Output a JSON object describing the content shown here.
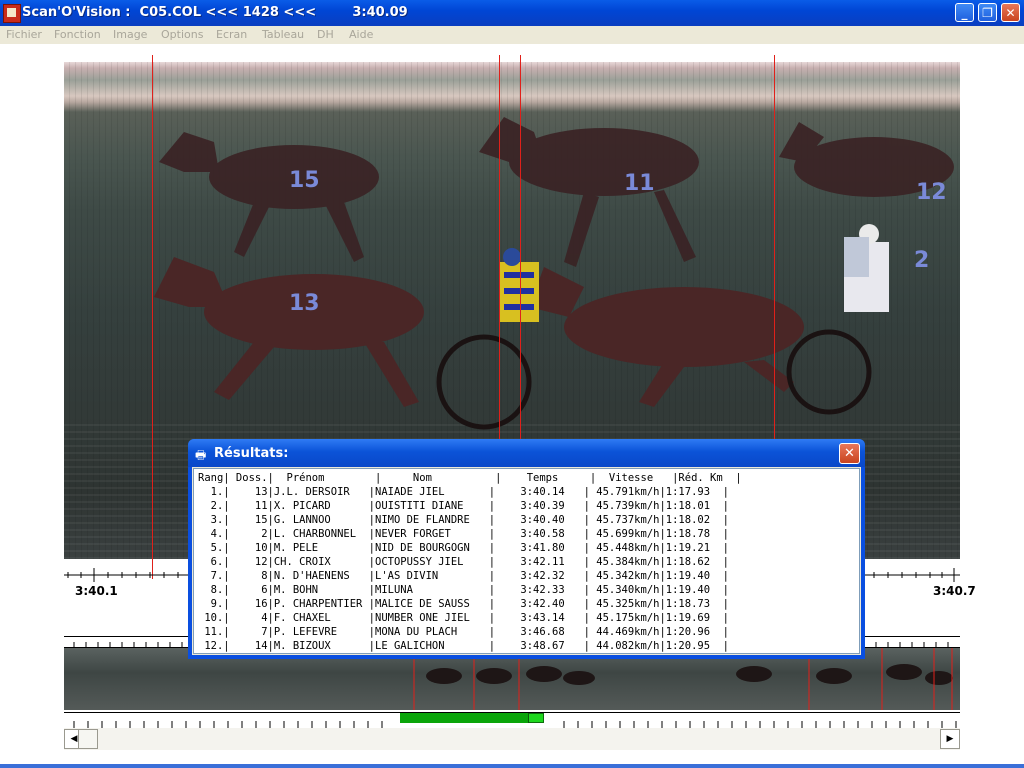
{
  "window": {
    "title": "Scan'O'Vision :  C05.COL <<< 1428 <<<        3:40.09",
    "controls": {
      "minimize": "_",
      "maximize": "❐",
      "close": "✕"
    }
  },
  "menu": [
    "Fichier",
    "Fonction",
    "Image",
    "Options",
    "Ecran",
    "Tableau",
    "DH",
    "Aide"
  ],
  "ruler": {
    "start_label": "3:40.1",
    "end_label": "3:40.7"
  },
  "dialog": {
    "title": "Résultats:",
    "header": "Rang| Doss.|  Prénom        |     Nom          |    Temps     |  Vitesse   |Réd. Km  |",
    "rows": [
      "  1.|    13|J.L. DERSOIR   |NAIADE JIEL       |    3:40.14   | 45.791km/h|1:17.93  |",
      "  2.|    11|X. PICARD      |OUISTITI DIANE    |    3:40.39   | 45.739km/h|1:18.01  |",
      "  3.|    15|G. LANNOO      |NIMO DE FLANDRE   |    3:40.40   | 45.737km/h|1:18.02  |",
      "  4.|     2|L. CHARBONNEL  |NEVER FORGET      |    3:40.58   | 45.699km/h|1:18.78  |",
      "  5.|    10|M. PELE        |NID DE BOURGOGN   |    3:41.80   | 45.448km/h|1:19.21  |",
      "  6.|    12|CH. CROIX      |OCTOPUSSY JIEL    |    3:42.11   | 45.384km/h|1:18.62  |",
      "  7.|     8|N. D'HAENENS   |L'AS DIVIN        |    3:42.32   | 45.342km/h|1:19.40  |",
      "  8.|     6|M. BOHN        |MILUNA            |    3:42.33   | 45.340km/h|1:19.40  |",
      "  9.|    16|P. CHARPENTIER |MALICE DE SAUSS   |    3:42.40   | 45.325km/h|1:18.73  |",
      " 10.|     4|F. CHAXEL      |NUMBER ONE JIEL   |    3:43.14   | 45.175km/h|1:19.69  |",
      " 11.|     7|P. LEFEVRE     |MONA DU PLACH     |    3:46.68   | 44.469km/h|1:20.96  |",
      " 12.|    14|M. BIZOUX      |LE GALICHON       |    3:48.67   | 44.082km/h|1:20.95  |"
    ]
  }
}
